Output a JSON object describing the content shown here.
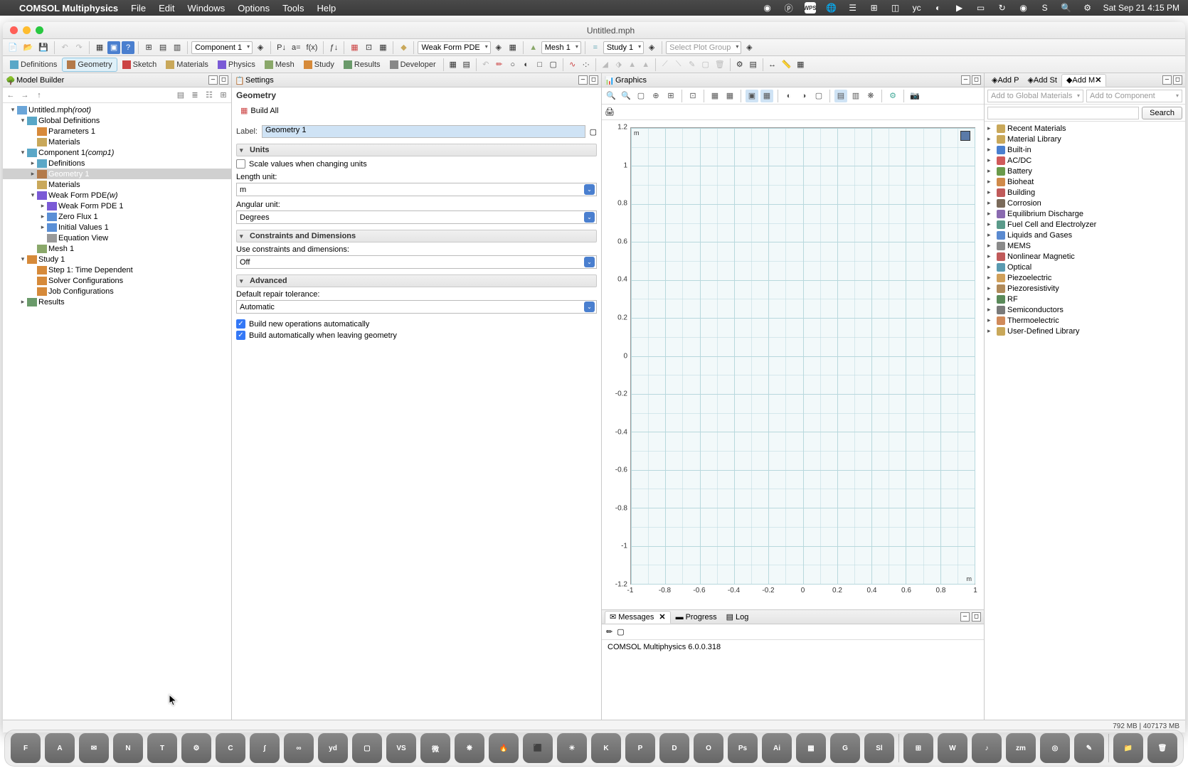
{
  "menubar": {
    "app": "COMSOL Multiphysics",
    "items": [
      "File",
      "Edit",
      "Windows",
      "Options",
      "Tools",
      "Help"
    ],
    "datetime": "Sat Sep 21  4:15 PM"
  },
  "window": {
    "title": "Untitled.mph"
  },
  "toolbar1": {
    "component_dd": "Component 1",
    "physics_dd": "Weak Form PDE",
    "mesh_dd": "Mesh 1",
    "study_dd": "Study 1",
    "plotgroup_dd": "Select Plot Group"
  },
  "ribbon": {
    "tabs": [
      "Definitions",
      "Geometry",
      "Sketch",
      "Materials",
      "Physics",
      "Mesh",
      "Study",
      "Results",
      "Developer"
    ],
    "active": 1
  },
  "model_builder": {
    "title": "Model Builder",
    "tree": [
      {
        "d": 0,
        "tw": "▾",
        "label": "Untitled.mph",
        "suffix": "(root)",
        "ital": true,
        "icon": "#6aa5d8"
      },
      {
        "d": 1,
        "tw": "▾",
        "label": "Global Definitions",
        "icon": "#5aa7c7"
      },
      {
        "d": 2,
        "tw": "",
        "label": "Parameters 1",
        "icon": "#d88a3a"
      },
      {
        "d": 2,
        "tw": "",
        "label": "Materials",
        "icon": "#c9a85a"
      },
      {
        "d": 1,
        "tw": "▾",
        "label": "Component 1",
        "suffix": "(comp1)",
        "ital": true,
        "icon": "#5aa7c7"
      },
      {
        "d": 2,
        "tw": "▸",
        "label": "Definitions",
        "icon": "#5aa7c7"
      },
      {
        "d": 2,
        "tw": "▸",
        "label": "Geometry 1",
        "icon": "#b37a4a",
        "sel": true
      },
      {
        "d": 2,
        "tw": "",
        "label": "Materials",
        "icon": "#c9a85a"
      },
      {
        "d": 2,
        "tw": "▾",
        "label": "Weak Form PDE",
        "suffix": "(w)",
        "ital": true,
        "icon": "#7a5ad6"
      },
      {
        "d": 3,
        "tw": "▸",
        "label": "Weak Form PDE 1",
        "icon": "#7a5ad6"
      },
      {
        "d": 3,
        "tw": "▸",
        "label": "Zero Flux 1",
        "icon": "#5a8fd6"
      },
      {
        "d": 3,
        "tw": "▸",
        "label": "Initial Values 1",
        "icon": "#5a8fd6"
      },
      {
        "d": 3,
        "tw": "",
        "label": "Equation View",
        "icon": "#999"
      },
      {
        "d": 2,
        "tw": "",
        "label": "Mesh 1",
        "icon": "#8aa86a"
      },
      {
        "d": 1,
        "tw": "▾",
        "label": "Study 1",
        "icon": "#d68a3a"
      },
      {
        "d": 2,
        "tw": "",
        "label": "Step 1: Time Dependent",
        "icon": "#d68a3a"
      },
      {
        "d": 2,
        "tw": "",
        "label": "Solver Configurations",
        "icon": "#d68a3a"
      },
      {
        "d": 2,
        "tw": "",
        "label": "Job Configurations",
        "icon": "#d68a3a"
      },
      {
        "d": 1,
        "tw": "▸",
        "label": "Results",
        "icon": "#6a9a6a"
      }
    ]
  },
  "settings": {
    "title": "Settings",
    "crumb": "Geometry",
    "build_all": "Build All",
    "label_lbl": "Label:",
    "label_val": "Geometry 1",
    "sec_units": "Units",
    "scale_values": "Scale values when changing units",
    "length_unit_lbl": "Length unit:",
    "length_unit_val": "m",
    "angular_unit_lbl": "Angular unit:",
    "angular_unit_val": "Degrees",
    "sec_constraints": "Constraints and Dimensions",
    "use_constraints_lbl": "Use constraints and dimensions:",
    "use_constraints_val": "Off",
    "sec_advanced": "Advanced",
    "repair_tol_lbl": "Default repair tolerance:",
    "repair_tol_val": "Automatic",
    "build_new": "Build new operations automatically",
    "build_leave": "Build automatically when leaving geometry"
  },
  "graphics": {
    "title": "Graphics",
    "y_ticks": [
      "1.2",
      "1",
      "0.8",
      "0.6",
      "0.4",
      "0.2",
      "0",
      "-0.2",
      "-0.4",
      "-0.6",
      "-0.8",
      "-1",
      "-1.2"
    ],
    "x_ticks": [
      "-1",
      "-0.8",
      "-0.6",
      "-0.4",
      "-0.2",
      "0",
      "0.2",
      "0.4",
      "0.6",
      "0.8",
      "1"
    ],
    "unit_y": "m",
    "unit_x": "m"
  },
  "materials_pane": {
    "tabs": [
      "Add P",
      "Add St",
      "Add M"
    ],
    "add_global": "Add to Global Materials",
    "add_component": "Add to Component",
    "search_btn": "Search",
    "items": [
      {
        "label": "Recent Materials",
        "c": "#c9a85a"
      },
      {
        "label": "Material Library",
        "c": "#c9a85a"
      },
      {
        "label": "Built-in",
        "c": "#4a7fcf"
      },
      {
        "label": "AC/DC",
        "c": "#d05a5a"
      },
      {
        "label": "Battery",
        "c": "#6a9a4a"
      },
      {
        "label": "Bioheat",
        "c": "#d08a4a"
      },
      {
        "label": "Building",
        "c": "#c05a5a"
      },
      {
        "label": "Corrosion",
        "c": "#7a6a5a"
      },
      {
        "label": "Equilibrium Discharge",
        "c": "#8a6ab0"
      },
      {
        "label": "Fuel Cell and Electrolyzer",
        "c": "#5a9a8a"
      },
      {
        "label": "Liquids and Gases",
        "c": "#5a8ad0"
      },
      {
        "label": "MEMS",
        "c": "#8a8a8a"
      },
      {
        "label": "Nonlinear Magnetic",
        "c": "#c05a5a"
      },
      {
        "label": "Optical",
        "c": "#5a9ab0"
      },
      {
        "label": "Piezoelectric",
        "c": "#d0a05a"
      },
      {
        "label": "Piezoresistivity",
        "c": "#b08a5a"
      },
      {
        "label": "RF",
        "c": "#5a8a5a"
      },
      {
        "label": "Semiconductors",
        "c": "#7a7a7a"
      },
      {
        "label": "Thermoelectric",
        "c": "#d08a5a"
      },
      {
        "label": "User-Defined Library",
        "c": "#c9a85a"
      }
    ]
  },
  "messages": {
    "tabs": [
      "Messages",
      "Progress",
      "Log"
    ],
    "text": "COMSOL Multiphysics 6.0.0.318"
  },
  "status": {
    "mem": "792 MB | 407173 MB"
  },
  "dock": {
    "apps": [
      "F",
      "A",
      "✉",
      "N",
      "T",
      "⚙",
      "C",
      "∫",
      "∞",
      "yd",
      "▢",
      "VS",
      "微",
      "❋",
      "🔥",
      "⬛",
      "☀",
      "K",
      "P",
      "D",
      "O",
      "Ps",
      "Ai",
      "▦",
      "G",
      "Sl"
    ],
    "apps2": [
      "⊞",
      "W",
      "♪",
      "zm",
      "◎",
      "✎"
    ],
    "apps3": [
      "📁",
      "🗑"
    ]
  }
}
